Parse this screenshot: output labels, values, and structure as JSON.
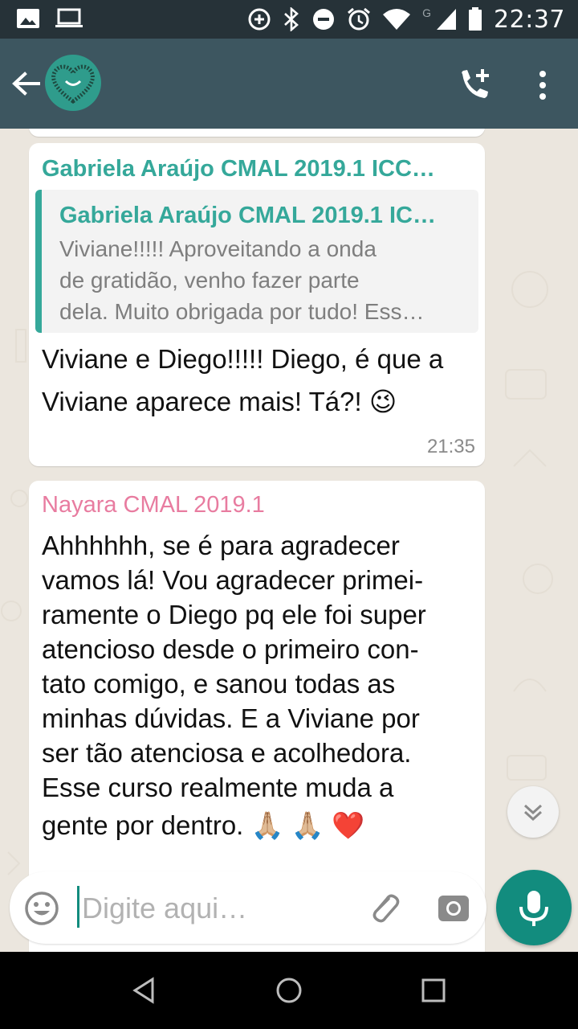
{
  "status_bar": {
    "time": "22:37",
    "network_label": "G",
    "icons": [
      "image-icon",
      "laptop-icon",
      "data-saver-icon",
      "bluetooth-icon",
      "do-not-disturb-icon",
      "alarm-icon",
      "wifi-icon",
      "signal-icon",
      "battery-icon"
    ]
  },
  "app_bar": {
    "icons": [
      "back-arrow-icon",
      "group-avatar",
      "add-call-icon",
      "more-vert-icon"
    ]
  },
  "messages": [
    {
      "sender": "Gabriela Araújo CMAL 2019.1 ICC…",
      "sender_color": "#35a89a",
      "quote": {
        "sender": "Gabriela Araújo CMAL 2019.1 IC…",
        "lines": [
          "Viviane!!!!! Aproveitando a onda",
          "de gratidão, venho fazer parte",
          "dela. Muito obrigada por tudo! Ess…"
        ]
      },
      "lines": [
        "Viviane e Diego!!!!! Diego, é que a",
        "Viviane aparece mais! Tá?! 😉"
      ],
      "time": "21:35"
    },
    {
      "sender": "Nayara CMAL 2019.1",
      "sender_color": "#e87ca0",
      "lines": [
        "Ahhhhhh, se é para agradecer",
        "vamos lá! Vou agradecer primei-",
        "ramente o Diego pq ele foi super",
        "atencioso desde o primeiro con-",
        "tato comigo, e sanou todas as",
        "minhas dúvidas. E a Viviane por",
        "ser tão atenciosa e acolhedora.",
        "Esse curso realmente muda a",
        "gente por dentro.  🙏🏼 🙏🏼 ❤️"
      ]
    }
  ],
  "composer": {
    "placeholder": "Digite aqui…",
    "value": ""
  },
  "colors": {
    "accent": "#128c7e",
    "app_bar": "#3d5660",
    "status_bar": "#263238",
    "chat_bg": "#ebe6de"
  }
}
